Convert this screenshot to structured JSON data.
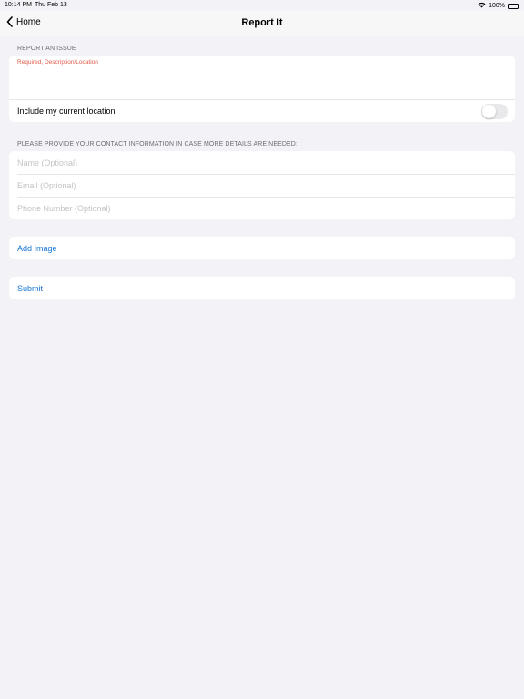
{
  "status_bar": {
    "time": "10:14 PM",
    "date": "Thu Feb 13",
    "battery": "100%",
    "battery_level": 1.0
  },
  "nav": {
    "back_label": "Home",
    "title": "Report It"
  },
  "report": {
    "header": "REPORT AN ISSUE",
    "description_hint": "Required, Description/Location",
    "include_location_label": "Include my current location",
    "include_location_on": false
  },
  "contact": {
    "header": "PLEASE PROVIDE YOUR CONTACT INFORMATION IN CASE MORE DETAILS ARE NEEDED:",
    "name_placeholder": "Name (Optional)",
    "email_placeholder": "Email (Optional)",
    "phone_placeholder": "Phone Number (Optional)"
  },
  "actions": {
    "add_image_label": "Add Image",
    "submit_label": "Submit"
  },
  "colors": {
    "accent": "#1676d6",
    "required": "#e05a4a",
    "background": "#f2f2f7"
  },
  "icons": {
    "back": "chevron-left-icon",
    "wifi": "wifi-icon",
    "battery": "battery-icon"
  }
}
